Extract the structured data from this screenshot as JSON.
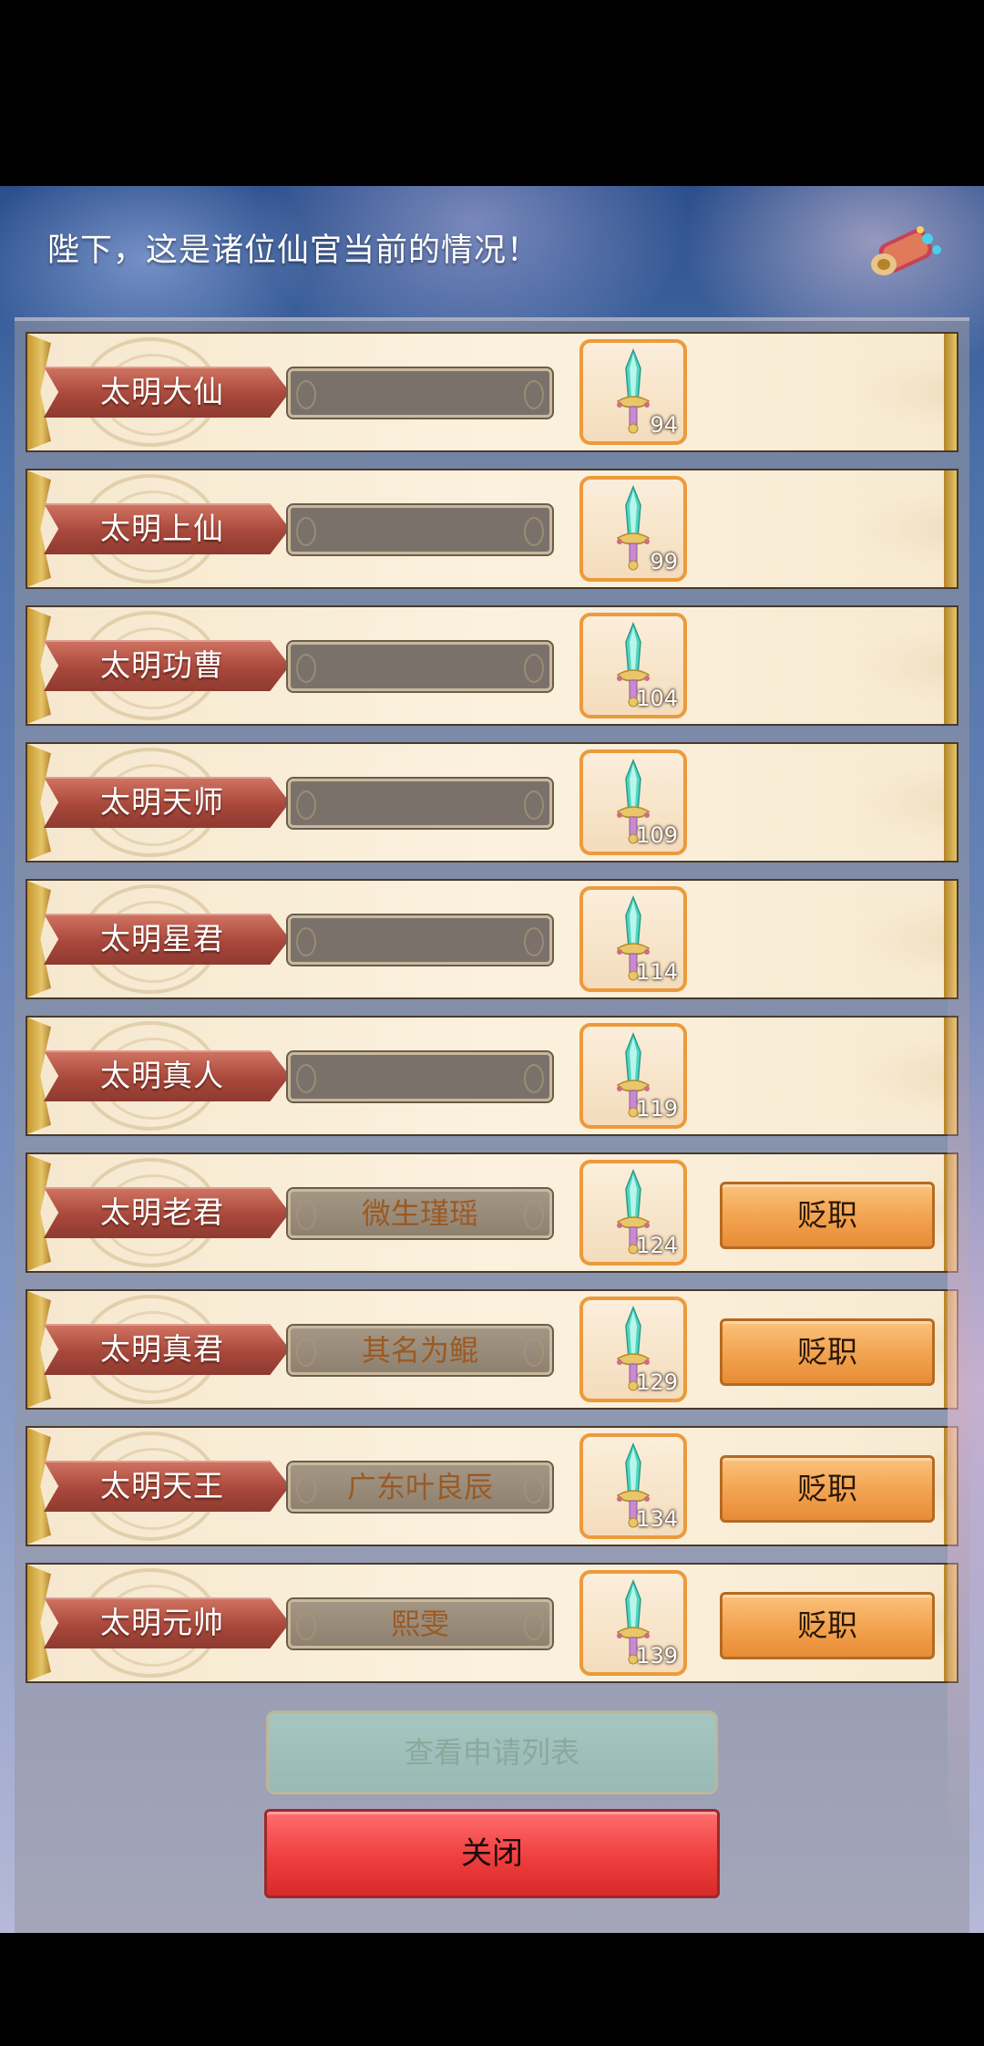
{
  "header": {
    "title": "陛下，这是诸位仙官当前的情况！",
    "scroll_icon": "scroll-icon"
  },
  "ranks": [
    {
      "title": "太明大仙",
      "official": "",
      "reward_count": "94",
      "reward_icon": "jade-sword-icon",
      "action": ""
    },
    {
      "title": "太明上仙",
      "official": "",
      "reward_count": "99",
      "reward_icon": "jade-sword-icon",
      "action": ""
    },
    {
      "title": "太明功曹",
      "official": "",
      "reward_count": "104",
      "reward_icon": "jade-sword-icon",
      "action": ""
    },
    {
      "title": "太明天师",
      "official": "",
      "reward_count": "109",
      "reward_icon": "jade-sword-icon",
      "action": ""
    },
    {
      "title": "太明星君",
      "official": "",
      "reward_count": "114",
      "reward_icon": "jade-sword-icon",
      "action": ""
    },
    {
      "title": "太明真人",
      "official": "",
      "reward_count": "119",
      "reward_icon": "jade-sword-icon",
      "action": ""
    },
    {
      "title": "太明老君",
      "official": "微生瑾瑶",
      "reward_count": "124",
      "reward_icon": "jade-sword-icon",
      "action": "贬职"
    },
    {
      "title": "太明真君",
      "official": "其名为鲲",
      "reward_count": "129",
      "reward_icon": "jade-sword-icon",
      "action": "贬职"
    },
    {
      "title": "太明天王",
      "official": "广东叶良辰",
      "reward_count": "134",
      "reward_icon": "jade-sword-icon",
      "action": "贬职"
    },
    {
      "title": "太明元帅",
      "official": "熙雯",
      "reward_count": "139",
      "reward_icon": "jade-sword-icon",
      "action": "贬职"
    }
  ],
  "footer": {
    "view_applications_label": "查看申请列表",
    "close_label": "关闭"
  },
  "colors": {
    "ribbon": "#a9483c",
    "demote_button": "#f2a24f",
    "close_button": "#ef3e3e",
    "reward_frame": "#ec9a3c"
  }
}
